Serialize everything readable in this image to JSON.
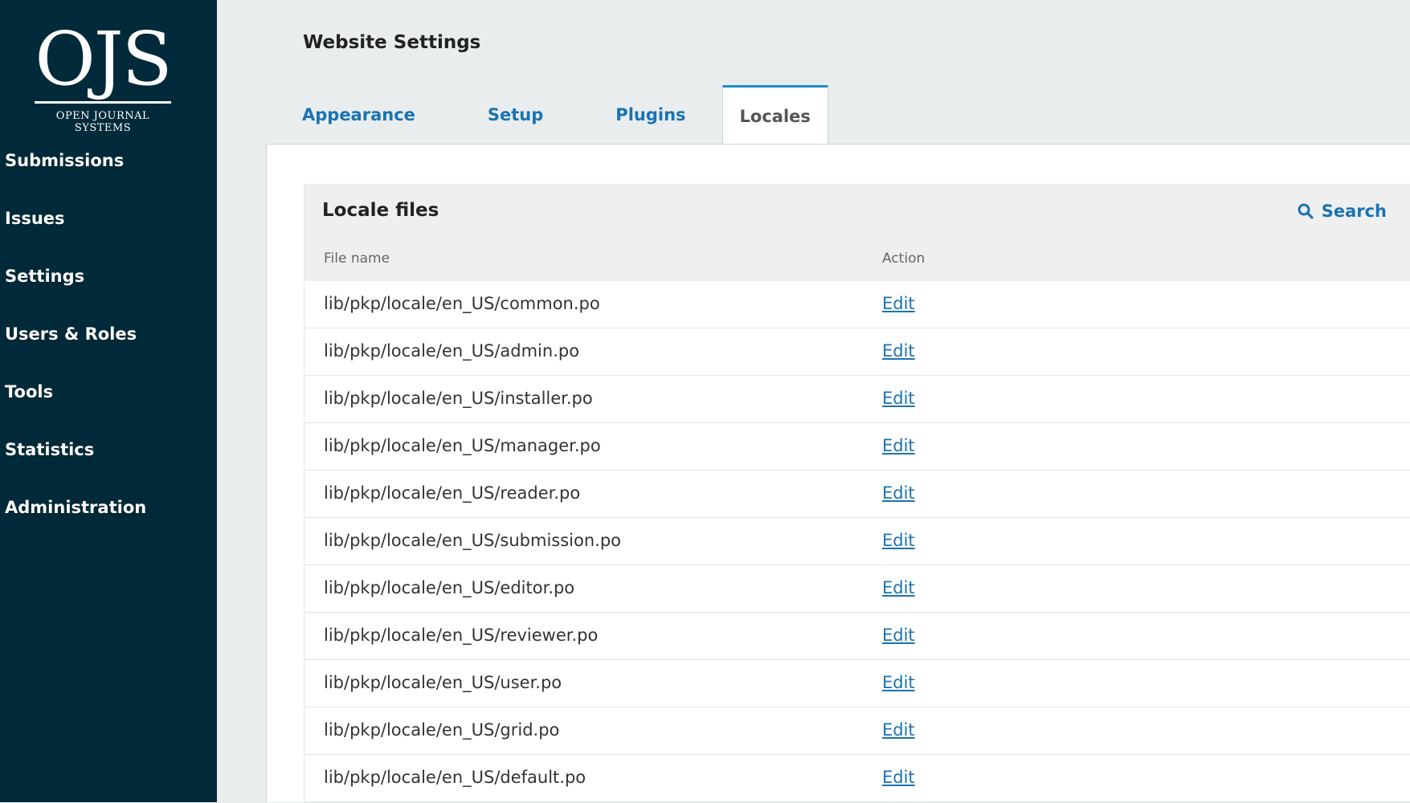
{
  "sidebar": {
    "logo_text": "OJS",
    "logo_subtitle": "OPEN JOURNAL SYSTEMS",
    "items": [
      {
        "label": "Submissions"
      },
      {
        "label": "Issues"
      },
      {
        "label": "Settings"
      },
      {
        "label": "Users & Roles"
      },
      {
        "label": "Tools"
      },
      {
        "label": "Statistics"
      },
      {
        "label": "Administration"
      }
    ]
  },
  "header": {
    "title": "Website Settings"
  },
  "tabs": [
    {
      "label": "Appearance",
      "active": false
    },
    {
      "label": "Setup",
      "active": false
    },
    {
      "label": "Plugins",
      "active": false
    },
    {
      "label": "Locales",
      "active": true
    }
  ],
  "grid": {
    "title": "Locale files",
    "search_label": "Search",
    "columns": {
      "file": "File name",
      "action": "Action"
    },
    "rows": [
      {
        "file": "lib/pkp/locale/en_US/common.po",
        "action": "Edit"
      },
      {
        "file": "lib/pkp/locale/en_US/admin.po",
        "action": "Edit"
      },
      {
        "file": "lib/pkp/locale/en_US/installer.po",
        "action": "Edit"
      },
      {
        "file": "lib/pkp/locale/en_US/manager.po",
        "action": "Edit"
      },
      {
        "file": "lib/pkp/locale/en_US/reader.po",
        "action": "Edit"
      },
      {
        "file": "lib/pkp/locale/en_US/submission.po",
        "action": "Edit"
      },
      {
        "file": "lib/pkp/locale/en_US/editor.po",
        "action": "Edit"
      },
      {
        "file": "lib/pkp/locale/en_US/reviewer.po",
        "action": "Edit"
      },
      {
        "file": "lib/pkp/locale/en_US/user.po",
        "action": "Edit"
      },
      {
        "file": "lib/pkp/locale/en_US/grid.po",
        "action": "Edit"
      },
      {
        "file": "lib/pkp/locale/en_US/default.po",
        "action": "Edit"
      }
    ]
  },
  "colors": {
    "sidebar_bg": "#002a3a",
    "link": "#1a73b3",
    "active_tab_border": "#1a8ec7"
  }
}
